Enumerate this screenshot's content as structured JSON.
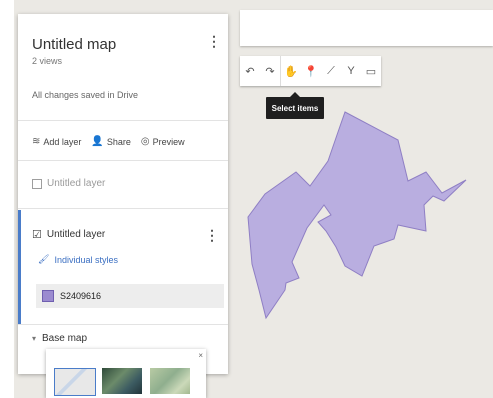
{
  "map": {
    "toolbar_items": [
      {
        "icon": "undo-icon",
        "glyph": "↶"
      },
      {
        "icon": "redo-icon",
        "glyph": "↷"
      },
      {
        "icon": "hand-icon",
        "glyph": "✋"
      },
      {
        "icon": "marker-icon",
        "glyph": "📍"
      },
      {
        "icon": "draw-line-icon",
        "glyph": "⟋"
      },
      {
        "icon": "route-icon",
        "glyph": "Y"
      },
      {
        "icon": "ruler-icon",
        "glyph": "▭"
      }
    ],
    "tooltip": "Select items",
    "shape_color": "#b9aee0",
    "shape_stroke": "#8f7fc4"
  },
  "panel": {
    "title": "Untitled map",
    "views": "2 views",
    "saved_status": "All changes saved in Drive",
    "actions": [
      {
        "icon": "add-layer-icon",
        "glyph": "≋",
        "label": "Add layer"
      },
      {
        "icon": "share-icon",
        "glyph": "👤",
        "label": "Share"
      },
      {
        "icon": "preview-icon",
        "glyph": "◎",
        "label": "Preview"
      }
    ],
    "layers": [
      {
        "label": "Untitled layer",
        "checked": false
      },
      {
        "label": "Untitled layer",
        "checked": true
      }
    ],
    "styles_label": "Individual styles",
    "feature_label": "S2409616",
    "basemap_label": "Base map",
    "basemap_close": "×"
  },
  "colors": {
    "accent": "#4a7cc9",
    "panel_bg": "#ffffff",
    "map_bg": "#ebe9e4"
  }
}
